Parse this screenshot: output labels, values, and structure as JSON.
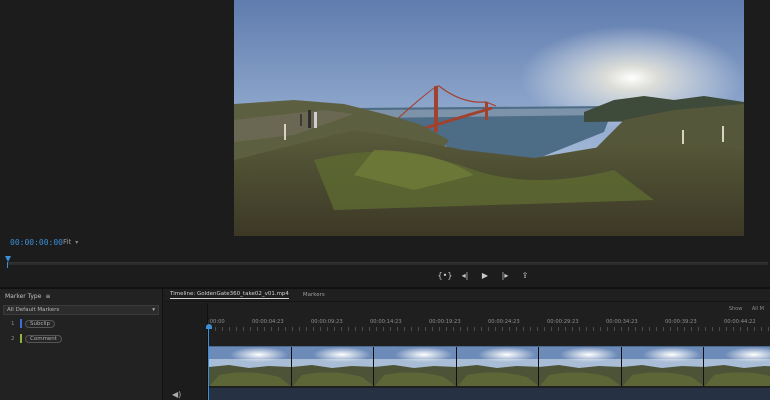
{
  "monitor": {
    "timecode": "00:00:00:00",
    "fit": "Fit"
  },
  "transport": {
    "buttons": [
      {
        "name": "mark-in-out-button",
        "glyph": "{•}"
      },
      {
        "name": "step-back-button",
        "glyph": "◂|"
      },
      {
        "name": "play-button",
        "glyph": "▶"
      },
      {
        "name": "step-forward-button",
        "glyph": "|▸"
      },
      {
        "name": "export-frame-button",
        "glyph": "⇪"
      }
    ]
  },
  "markers_panel": {
    "title": "Marker Type",
    "menu_icon": "≡",
    "filter": "All Default Markers",
    "items": [
      {
        "num": "1",
        "label": "Subclip",
        "color": "#3b6fd8"
      },
      {
        "num": "2",
        "label": "Comment",
        "color": "#8fb83a"
      }
    ]
  },
  "timeline": {
    "tabs": [
      "Timeline: GoldenGate360_take02_v01.mp4",
      "Markers"
    ],
    "show_label": "Show",
    "show_value": "All M",
    "ruler_labels": [
      ":00:00",
      "00:00:04:23",
      "00:00:09:23",
      "00:00:14:23",
      "00:00:19:23",
      "00:00:24:23",
      "00:00:29:23",
      "00:00:34:23",
      "00:00:39:23",
      "00:00:44:22"
    ],
    "thumbnail_count": 7
  }
}
